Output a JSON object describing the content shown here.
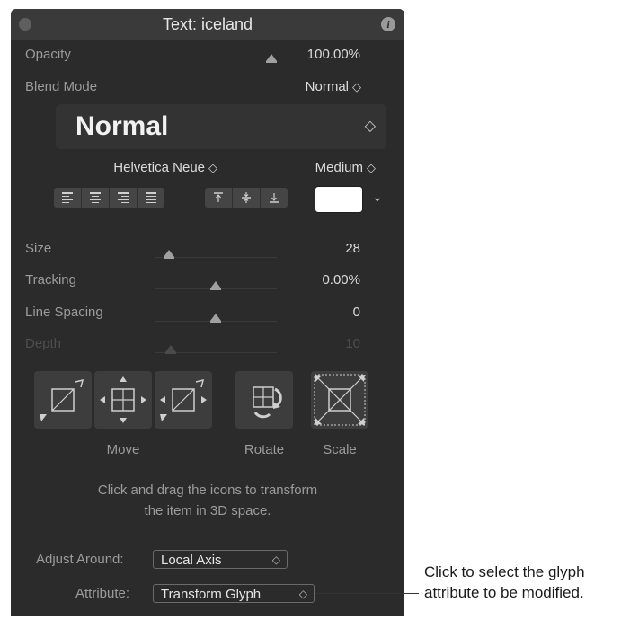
{
  "window": {
    "title": "Text: iceland"
  },
  "rows": {
    "opacity": {
      "label": "Opacity",
      "value": "100.00%"
    },
    "blend_mode": {
      "label": "Blend Mode",
      "value": "Normal"
    },
    "size": {
      "label": "Size",
      "value": "28"
    },
    "tracking": {
      "label": "Tracking",
      "value": "0.00%"
    },
    "line_spacing": {
      "label": "Line Spacing",
      "value": "0"
    },
    "depth": {
      "label": "Depth",
      "value": "10"
    }
  },
  "sliders": {
    "opacity": 1.0,
    "size": 0.1,
    "tracking": 0.5,
    "line_spacing": 0.5,
    "depth": 0.1
  },
  "preset": {
    "value": "Normal"
  },
  "font": {
    "family": "Helvetica Neue",
    "weight": "Medium"
  },
  "color": {
    "swatch": "#ffffff"
  },
  "alignment": {
    "horizontal_icons": [
      "align-left-icon",
      "align-center-icon",
      "align-right-icon",
      "justify-icon"
    ],
    "vertical_icons": [
      "align-top-icon",
      "align-middle-icon",
      "align-bottom-icon"
    ]
  },
  "transform": {
    "move_label": "Move",
    "rotate_label": "Rotate",
    "scale_label": "Scale"
  },
  "help": {
    "line1": "Click and drag the icons to transform",
    "line2": "the item in 3D space."
  },
  "adjust_around": {
    "label": "Adjust Around:",
    "value": "Local Axis"
  },
  "attribute": {
    "label": "Attribute:",
    "value": "Transform Glyph"
  },
  "callout": {
    "line1": "Click to select the glyph",
    "line2": "attribute to be modified."
  }
}
